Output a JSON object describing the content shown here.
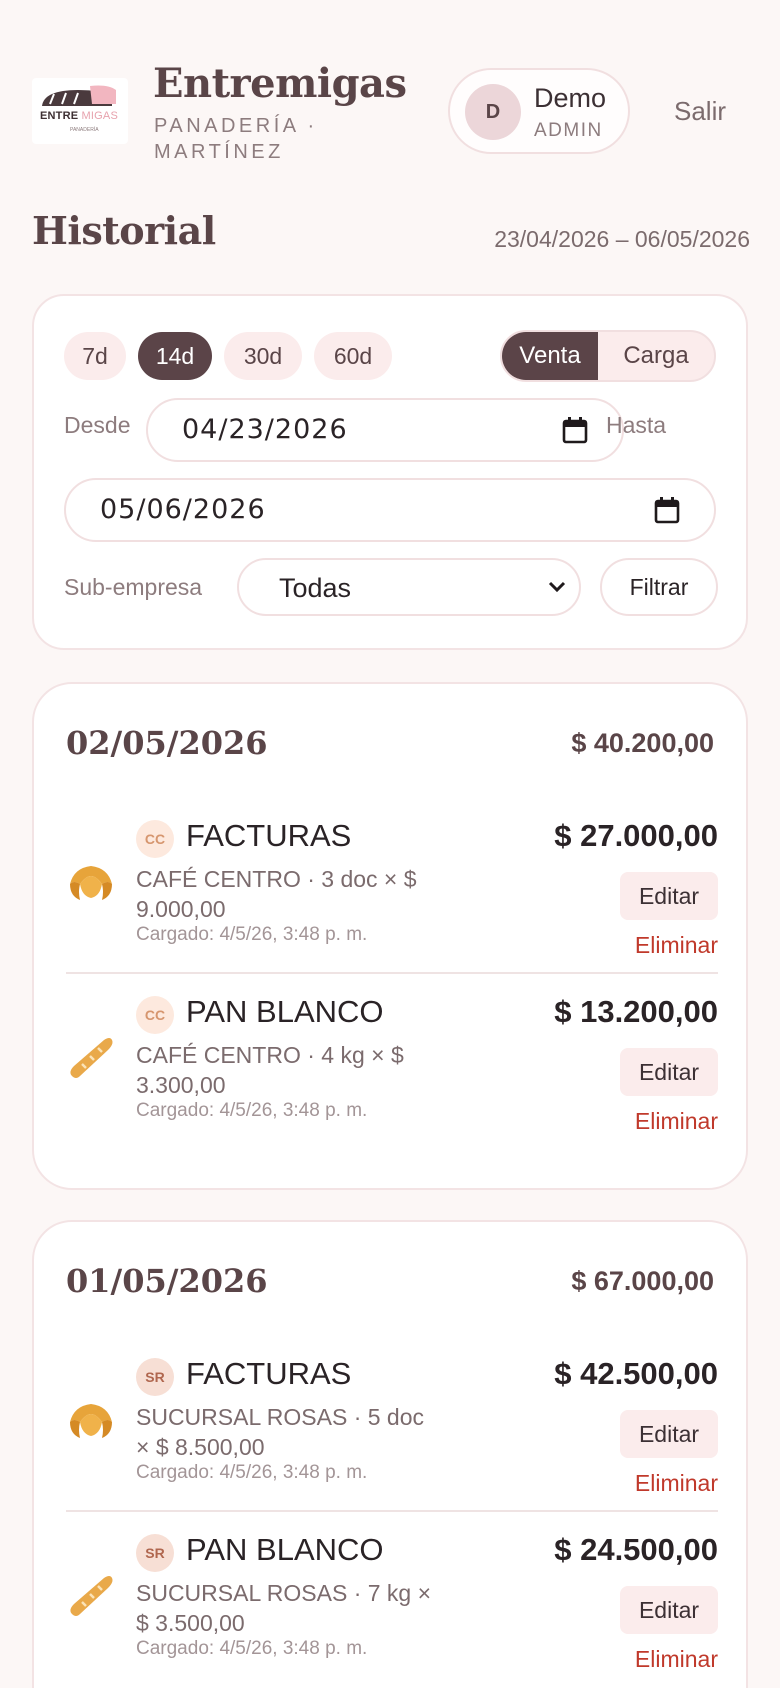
{
  "header": {
    "logo_text": "ENTRE MIGAS",
    "logo_text_main": "ENTRE",
    "logo_text_accent": "MIGAS",
    "logo_subtext": "PANADERÍA",
    "brand": "Entremigas",
    "subtitle": "PANADERÍA · MARTÍNEZ",
    "user": {
      "initial": "D",
      "name": "Demo",
      "role": "ADMIN"
    },
    "logout_label": "Salir"
  },
  "page": {
    "title": "Historial",
    "date_range": "23/04/2026 – 06/05/2026"
  },
  "filters": {
    "periods": [
      "7d",
      "14d",
      "30d",
      "60d"
    ],
    "active_period": "14d",
    "modes": [
      "Venta",
      "Carga"
    ],
    "active_mode": "Venta",
    "from_label": "Desde",
    "from_value": "04/23/2026",
    "to_label": "Hasta",
    "to_value": "05/06/2026",
    "subcompany_label": "Sub-empresa",
    "subcompany_value": "Todas",
    "filter_button": "Filtrar"
  },
  "days": [
    {
      "date": "02/05/2026",
      "total": "$ 40.200,00",
      "entries": [
        {
          "icon": "croissant-icon",
          "badge": "CC",
          "name": "FACTURAS",
          "desc": "CAFÉ CENTRO · 3 doc × $ 9.000,00",
          "loaded": "Cargado: 4/5/26, 3:48 p. m.",
          "amount": "$ 27.000,00",
          "edit": "Editar",
          "delete": "Eliminar"
        },
        {
          "icon": "baguette-icon",
          "badge": "CC",
          "name": "PAN BLANCO",
          "desc": "CAFÉ CENTRO · 4 kg × $ 3.300,00",
          "loaded": "Cargado: 4/5/26, 3:48 p. m.",
          "amount": "$ 13.200,00",
          "edit": "Editar",
          "delete": "Eliminar"
        }
      ]
    },
    {
      "date": "01/05/2026",
      "total": "$ 67.000,00",
      "entries": [
        {
          "icon": "croissant-icon",
          "badge": "SR",
          "name": "FACTURAS",
          "desc": "SUCURSAL ROSAS · 5 doc × $ 8.500,00",
          "loaded": "Cargado: 4/5/26, 3:48 p. m.",
          "amount": "$ 42.500,00",
          "edit": "Editar",
          "delete": "Eliminar"
        },
        {
          "icon": "baguette-icon",
          "badge": "SR",
          "name": "PAN BLANCO",
          "desc": "SUCURSAL ROSAS · 7 kg × $ 3.500,00",
          "loaded": "Cargado: 4/5/26, 3:48 p. m.",
          "amount": "$ 24.500,00",
          "edit": "Editar",
          "delete": "Eliminar"
        }
      ]
    }
  ]
}
